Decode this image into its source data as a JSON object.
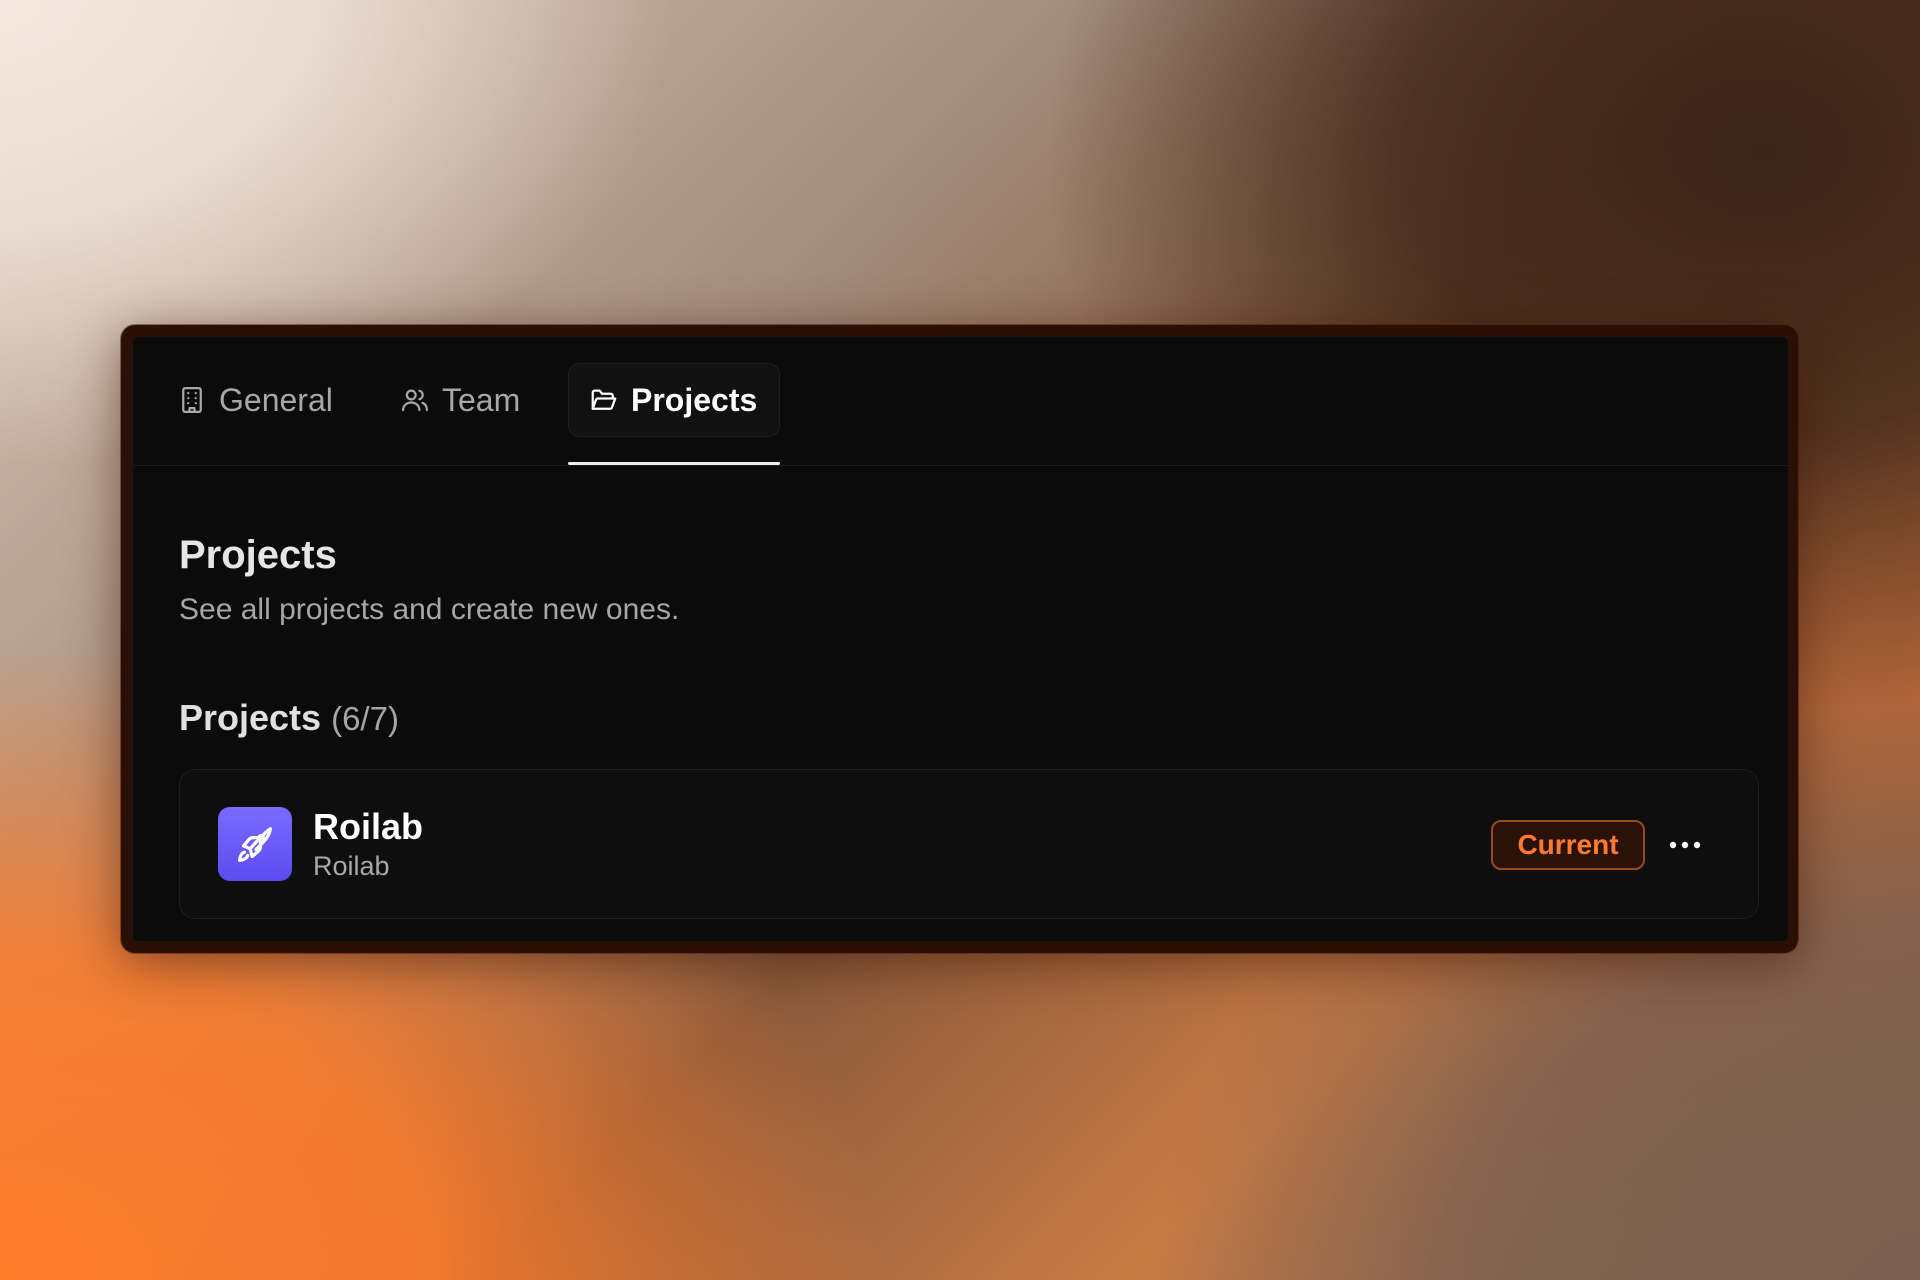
{
  "tabs": [
    {
      "label": "General",
      "icon": "building-icon",
      "active": false
    },
    {
      "label": "Team",
      "icon": "users-icon",
      "active": false
    },
    {
      "label": "Projects",
      "icon": "folder-open-icon",
      "active": true
    }
  ],
  "header": {
    "title": "Projects",
    "subtitle": "See all projects and create new ones."
  },
  "projects_section": {
    "title": "Projects",
    "count": "(6/7)"
  },
  "project": {
    "name": "Roilab",
    "slug": "Roilab",
    "icon": "rocket-icon",
    "badge": "Current",
    "menu_icon": "more-horizontal-icon"
  },
  "colors": {
    "panel_bg": "#0b0b0b",
    "accent_orange": "#ff7a2e",
    "project_icon_bg": "#6a5af9"
  }
}
